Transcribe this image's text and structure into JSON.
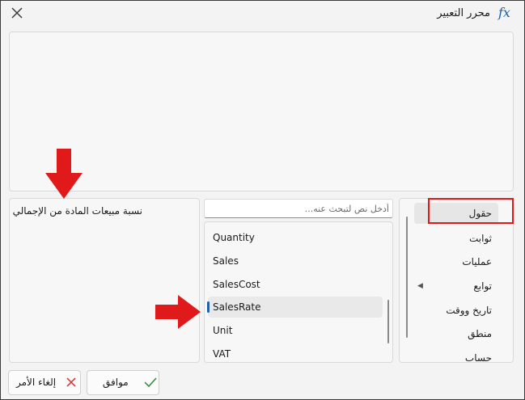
{
  "window": {
    "title": "محرر التعبير",
    "fx_label": "fx",
    "close_icon": "close-icon"
  },
  "description": {
    "text": "نسبة مبيعات المادة من الإجمالي"
  },
  "search": {
    "placeholder": "أدخل نص لتبحث عنه..."
  },
  "fields": {
    "items": [
      {
        "label": "Quantity"
      },
      {
        "label": "Sales"
      },
      {
        "label": "SalesCost"
      },
      {
        "label": "SalesRate",
        "selected": true
      },
      {
        "label": "Unit"
      },
      {
        "label": "VAT"
      }
    ]
  },
  "categories": {
    "items": [
      {
        "label": "حقول",
        "selected": true
      },
      {
        "label": "ثوابت"
      },
      {
        "label": "عمليات"
      },
      {
        "label": "توابع",
        "expandable": true
      },
      {
        "label": "تاريخ ووقت"
      },
      {
        "label": "منطق"
      },
      {
        "label": "حساب"
      }
    ]
  },
  "buttons": {
    "ok_label": "موافق",
    "cancel_label": "إلغاء الأمر"
  },
  "colors": {
    "accent": "#1e5fa8",
    "annotation_red": "#e0191b",
    "ok_check": "#2e8b3a",
    "cancel_x": "#d32f2f"
  }
}
